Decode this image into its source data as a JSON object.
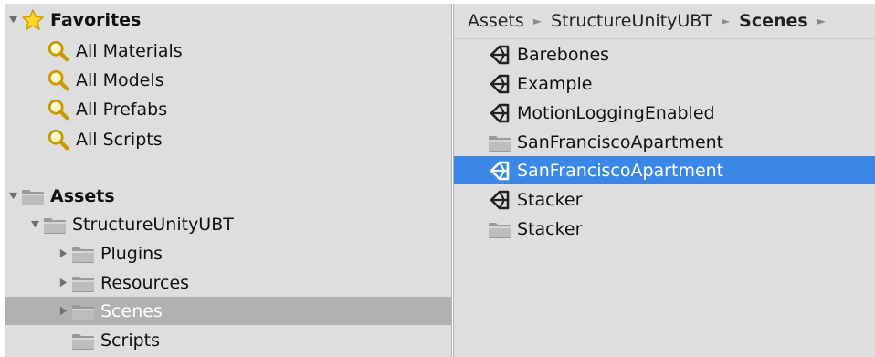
{
  "favorites": {
    "label": "Favorites",
    "items": [
      {
        "label": "All Materials"
      },
      {
        "label": "All Models"
      },
      {
        "label": "All Prefabs"
      },
      {
        "label": "All Scripts"
      }
    ]
  },
  "assets": {
    "label": "Assets",
    "root": {
      "label": "StructureUnityUBT",
      "children": [
        {
          "label": "Plugins"
        },
        {
          "label": "Resources"
        },
        {
          "label": "Scenes"
        },
        {
          "label": "Scripts"
        }
      ]
    }
  },
  "breadcrumb": {
    "items": [
      "Assets",
      "StructureUnityUBT",
      "Scenes"
    ],
    "separator": "►"
  },
  "content": {
    "items": [
      {
        "label": "Barebones",
        "icon": "unity-scene-icon"
      },
      {
        "label": "Example",
        "icon": "unity-scene-icon"
      },
      {
        "label": "MotionLoggingEnabled",
        "icon": "unity-scene-icon"
      },
      {
        "label": "SanFranciscoApartment",
        "icon": "folder-icon"
      },
      {
        "label": "SanFranciscoApartment",
        "icon": "unity-scene-icon"
      },
      {
        "label": "Stacker",
        "icon": "unity-scene-icon"
      },
      {
        "label": "Stacker",
        "icon": "folder-icon"
      }
    ]
  },
  "colors": {
    "selection_blue": "#3a87e5",
    "selection_gray": "#b1b1b1",
    "panel_bg": "#dedede"
  }
}
